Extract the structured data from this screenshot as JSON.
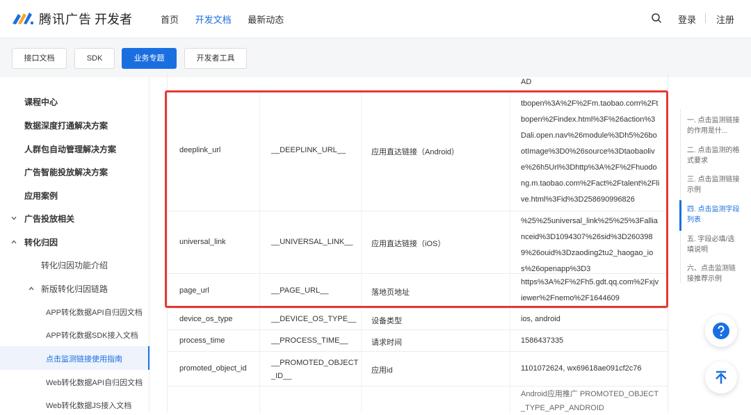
{
  "header": {
    "brand": "腾讯广告",
    "brand_sub": "开发者",
    "nav": [
      "首页",
      "开发文档",
      "最新动态"
    ],
    "login": "登录",
    "register": "注册"
  },
  "tabs": [
    "接口文档",
    "SDK",
    "业务专题",
    "开发者工具"
  ],
  "sidebar": {
    "items": [
      "课程中心",
      "数据深度打通解决方案",
      "人群包自动管理解决方案",
      "广告智能投放解决方案",
      "应用案例",
      "广告投放相关",
      "转化归因"
    ],
    "sub_items": [
      "转化归因功能介绍",
      "新版转化归因链路"
    ],
    "leaf_items": [
      "APP转化数据API自归因文档",
      "APP转化数据SDK接入文档",
      "点击监测链接使用指南",
      "Web转化数据API自归因文档",
      "Web转化数据JS接入文档"
    ]
  },
  "table": {
    "top_partial": "AD",
    "rows": [
      {
        "field": "deeplink_url",
        "macro": "__DEEPLINK_URL__",
        "desc": "应用直达链接（Android）",
        "example": "tbopen%3A%2F%2Fm.taobao.com%2Ftbopen%2Findex.html%3F%26action%3Dali.open.nav%26module%3Dh5%26bootImage%3D0%26source%3Dtaobaolive%26h5Url%3Dhttp%3A%2F%2Fhuodong.m.taobao.com%2Fact%2Ftalent%2Flive.html%3Fid%3D258690996826"
      },
      {
        "field": "universal_link",
        "macro": "__UNIVERSAL_LINK__",
        "desc": "应用直达链接（iOS）",
        "example": "%25%25universal_link%25%25%3Fallianceid%3D1094307%26sid%3D2603989%26ouid%3Dzaoding2tu2_haogao_ios%26openapp%3D3"
      },
      {
        "field": "page_url",
        "macro": "__PAGE_URL__",
        "desc": "落地页地址",
        "example": "https%3A%2F%2Fh5.gdt.qq.com%2Fxjviewer%2Fnemo%2F1644609"
      },
      {
        "field": "device_os_type",
        "macro": "__DEVICE_OS_TYPE__",
        "desc": "设备类型",
        "example": "ios, android"
      },
      {
        "field": "process_time",
        "macro": "__PROCESS_TIME__",
        "desc": "请求时间",
        "example": "1586437335"
      },
      {
        "field": "promoted_object_id",
        "macro": "__PROMOTED_OBJECT_ID__",
        "desc": "应用id",
        "example": "1101072624, wx69618ae091cf2c76"
      }
    ],
    "bottom_partial": "Android应用推广 PROMOTED_OBJECT_TYPE_APP_ANDROID"
  },
  "toc": [
    "一. 点击监测链接的作用是什...",
    "二. 点击监测的格式要求",
    "三. 点击监测链接示例",
    "四. 点击监测字段列表",
    "五. 字段必填/选填说明",
    "六、点击监测链接推荐示例"
  ],
  "colors": {
    "accent": "#1a6fe0",
    "highlight": "#e53935"
  }
}
